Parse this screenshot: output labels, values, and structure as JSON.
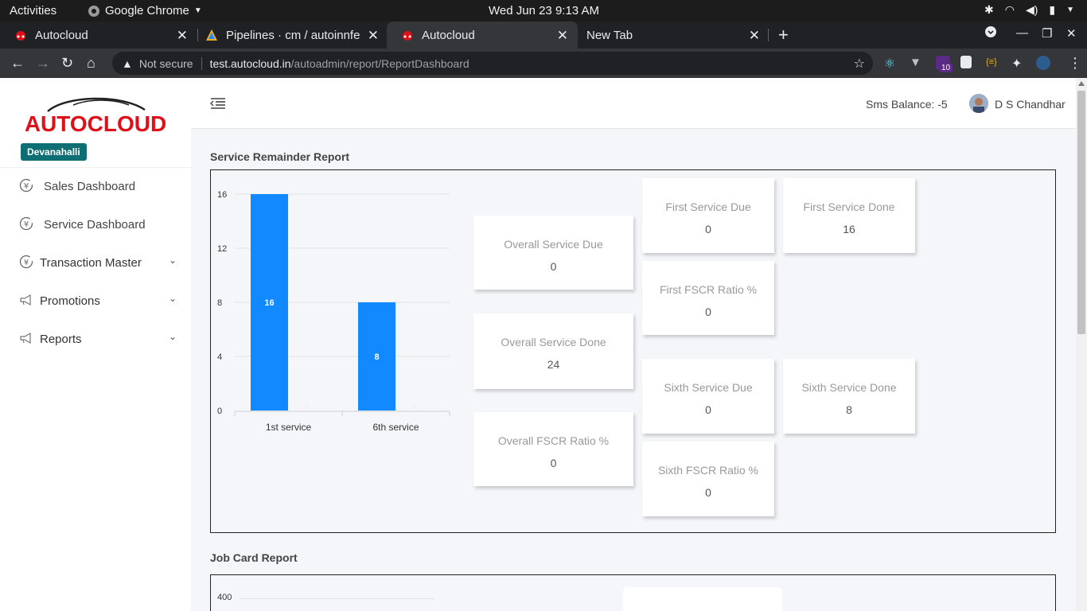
{
  "os_bar": {
    "activities": "Activities",
    "app_name": "Google Chrome",
    "datetime": "Wed Jun 23  9:13 AM"
  },
  "tabs": [
    {
      "title": "Autocloud",
      "active": false
    },
    {
      "title": "Pipelines · cm / autoinnfe",
      "active": false
    },
    {
      "title": "Autocloud",
      "active": true
    },
    {
      "title": "New Tab",
      "active": false
    }
  ],
  "address_bar": {
    "security": "Not secure",
    "host": "test.autocloud.in",
    "path": "/autoadmin/report/ReportDashboard"
  },
  "extensions": {
    "badge_count": "10"
  },
  "app": {
    "logo_text": "AUTOCLOUD",
    "branch": "Devanahalli",
    "nav": [
      {
        "label": "Sales Dashboard",
        "icon": "rupee-cycle-icon",
        "has_children": false
      },
      {
        "label": "Service Dashboard",
        "icon": "rupee-cycle-icon",
        "has_children": false
      },
      {
        "label": "Transaction Master",
        "icon": "rupee-cycle-icon",
        "has_children": true
      },
      {
        "label": "Promotions",
        "icon": "megaphone-icon",
        "has_children": true
      },
      {
        "label": "Reports",
        "icon": "megaphone-icon",
        "has_children": true
      }
    ],
    "header": {
      "sms_balance": "Sms Balance: -5",
      "user_name": "D S Chandhar"
    }
  },
  "service_report": {
    "title": "Service Remainder Report",
    "overall": [
      {
        "label": "Overall Service Due",
        "value": "0"
      },
      {
        "label": "Overall Service Done",
        "value": "24"
      },
      {
        "label": "Overall FSCR Ratio %",
        "value": "0"
      }
    ],
    "first": [
      {
        "label": "First Service Due",
        "value": "0"
      },
      {
        "label": "First Service Done",
        "value": "16"
      },
      {
        "label": "First FSCR Ratio %",
        "value": "0"
      }
    ],
    "sixth": [
      {
        "label": "Sixth Service Due",
        "value": "0"
      },
      {
        "label": "Sixth Service Done",
        "value": "8"
      },
      {
        "label": "Sixth FSCR Ratio %",
        "value": "0"
      }
    ]
  },
  "job_card_report": {
    "title": "Job Card Report",
    "y_first_tick": "400"
  },
  "colors": {
    "bar_primary": "#1289ff",
    "brand_red": "#e0101a",
    "branch_badge": "#0d6e73"
  },
  "chart_data": {
    "type": "bar",
    "categories": [
      "1st service",
      "6th service"
    ],
    "series": [
      {
        "values": [
          16,
          8
        ]
      },
      {
        "values": [
          0,
          0
        ]
      }
    ],
    "yticks": [
      0,
      4,
      8,
      12,
      16
    ],
    "ylim": [
      0,
      16
    ],
    "title": "",
    "xlabel": "",
    "ylabel": "",
    "grid": true
  }
}
